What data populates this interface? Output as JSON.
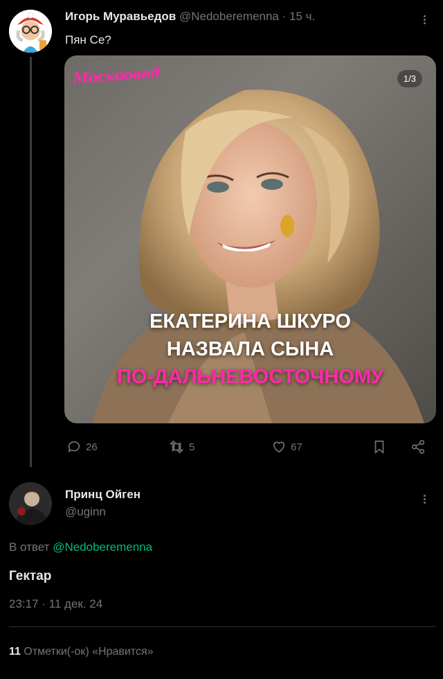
{
  "tweet": {
    "author_name": "Игорь Муравьедов",
    "handle": "@Nedoberemenna",
    "separator": "·",
    "time": "15 ч.",
    "text": "Пян Се?",
    "media": {
      "logo": "Москвовед",
      "counter": "1/3",
      "caption_line1": "ЕКАТЕРИНА ШКУРО",
      "caption_line2": "НАЗВАЛА СЫНА",
      "caption_line3": "ПО-ДАЛЬНЕВОСТОЧНОМУ",
      "caption_accent_color": "#ff2aa8"
    },
    "actions": {
      "replies": "26",
      "retweets": "5",
      "likes": "67"
    }
  },
  "reply": {
    "author_name": "Принц Ойген",
    "handle": "@uginn",
    "reply_to_prefix": "В ответ",
    "reply_to_handle": "@Nedoberemenna",
    "text": "Гектар",
    "date": "23:17 · 11 дек. 24",
    "likes_count": "11",
    "likes_label": "Отметки(-ок) «Нравится»"
  },
  "colors": {
    "background": "#000000",
    "text": "#e7e9ea",
    "muted": "#71767b",
    "link": "#00ba7c",
    "divider": "#2f3336"
  },
  "icons": [
    "more-icon",
    "reply-icon",
    "retweet-icon",
    "like-icon",
    "bookmark-icon",
    "share-icon"
  ]
}
